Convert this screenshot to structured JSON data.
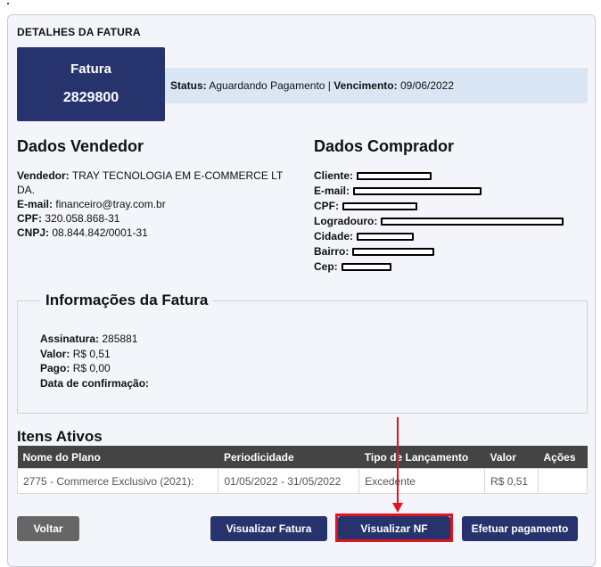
{
  "page": {
    "section_title": "DETALHES DA FATURA"
  },
  "invoice": {
    "label": "Fatura",
    "number": "2829800",
    "status_label": "Status:",
    "status_value": "Aguardando Pagamento",
    "separator": "|",
    "due_label": "Vencimento:",
    "due_value": "09/06/2022"
  },
  "seller": {
    "title": "Dados Vendedor",
    "rows": [
      {
        "label": "Vendedor:",
        "value": "TRAY TECNOLOGIA EM E-COMMERCE LT"
      },
      {
        "label": "",
        "value": "DA."
      },
      {
        "label": "E-mail:",
        "value": "financeiro@tray.com.br"
      },
      {
        "label": "CPF:",
        "value": "320.058.868-31"
      },
      {
        "label": "CNPJ:",
        "value": "08.844.842/0001-31"
      }
    ]
  },
  "buyer": {
    "title": "Dados Comprador",
    "rows": [
      {
        "label": "Cliente:"
      },
      {
        "label": "E-mail:"
      },
      {
        "label": "CPF:"
      },
      {
        "label": "Logradouro:"
      },
      {
        "label": "Cidade:"
      },
      {
        "label": "Bairro:"
      },
      {
        "label": "Cep:"
      }
    ]
  },
  "invoice_info": {
    "title": "Informações da Fatura",
    "rows": [
      {
        "label": "Assinatura:",
        "value": "285881"
      },
      {
        "label": "Valor:",
        "value": "R$ 0,51"
      },
      {
        "label": "Pago:",
        "value": "R$ 0,00"
      },
      {
        "label": "Data de confirmação:",
        "value": ""
      }
    ]
  },
  "items": {
    "title": "Itens Ativos",
    "headers": [
      "Nome do Plano",
      "Periodicidade",
      "Tipo de Lançamento",
      "Valor",
      "Ações"
    ],
    "rows": [
      [
        "2775 - Commerce Exclusivo (2021):",
        "01/05/2022 - 31/05/2022",
        "Excedente",
        "R$ 0,51",
        ""
      ]
    ]
  },
  "buttons": {
    "back": "Voltar",
    "view_invoice": "Visualizar Fatura",
    "view_nf": "Visualizar NF",
    "pay": "Efetuar pagamento"
  },
  "colors": {
    "primary": "#26336d",
    "highlight": "#e0141e",
    "status_bg": "#dbe6f5"
  }
}
